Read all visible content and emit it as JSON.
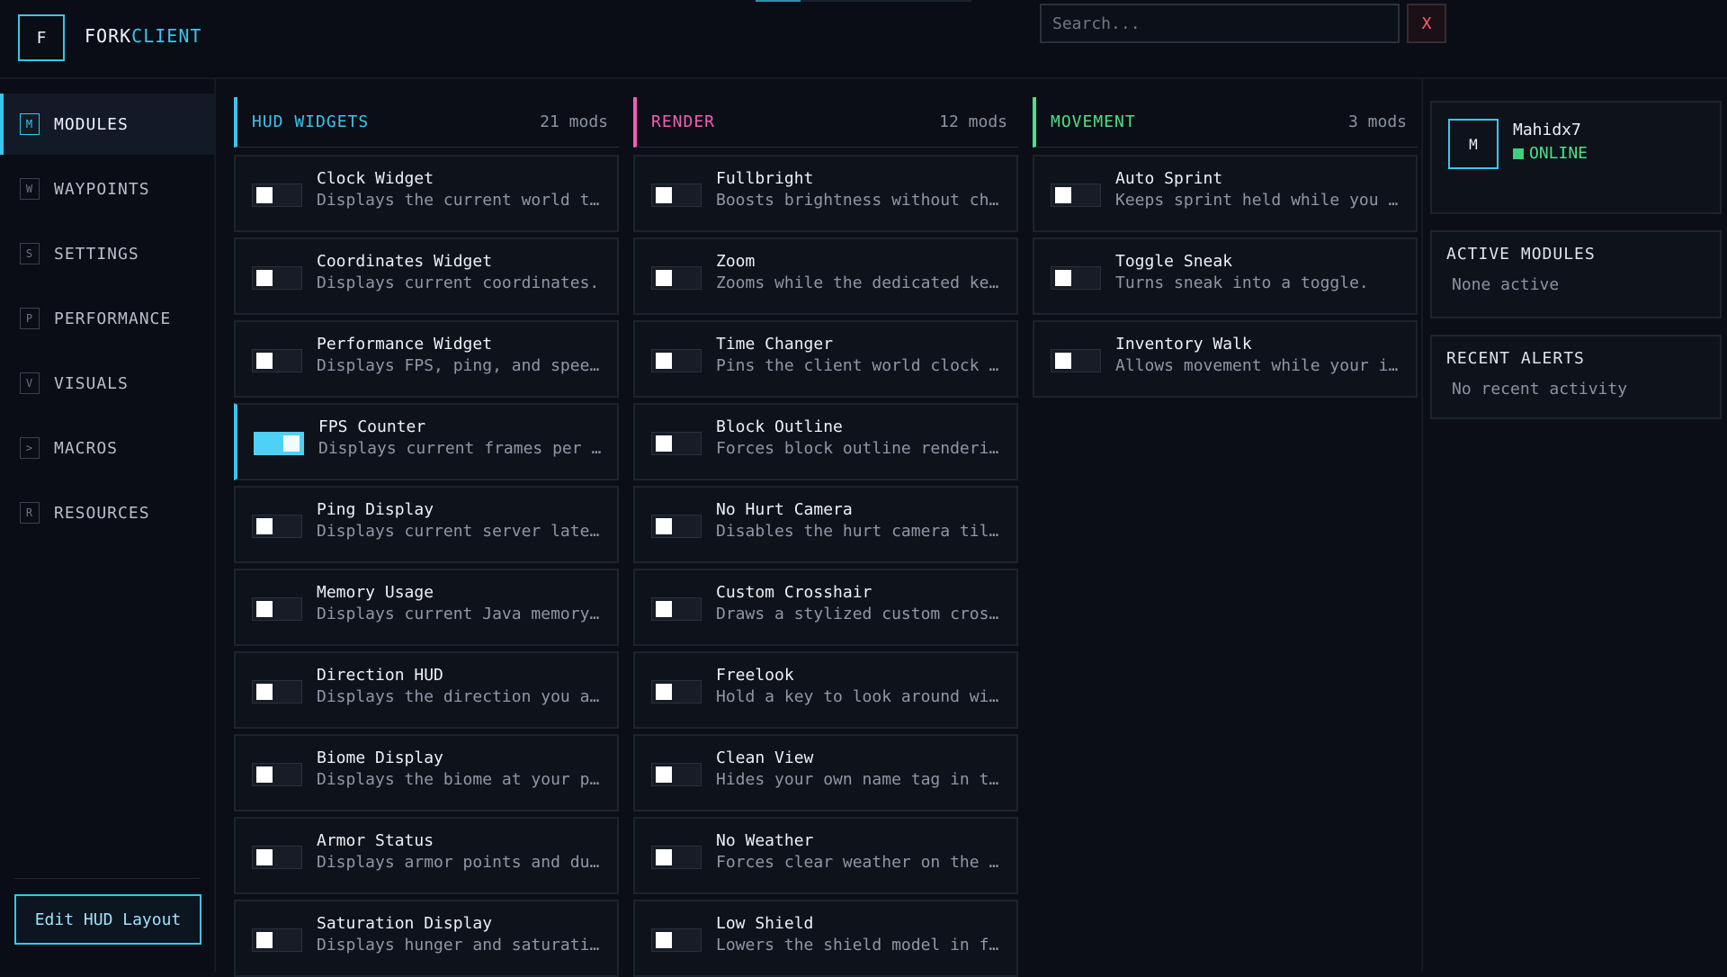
{
  "brand": {
    "logo_letter": "F",
    "name_primary": "FORK",
    "name_accent": "CLIENT",
    "accent_color": "#38c6ee"
  },
  "search": {
    "placeholder": "Search...",
    "clear_label": "X"
  },
  "sidebar": {
    "items": [
      {
        "icon": "M",
        "label": "MODULES",
        "active": true
      },
      {
        "icon": "W",
        "label": "WAYPOINTS",
        "active": false
      },
      {
        "icon": "S",
        "label": "SETTINGS",
        "active": false
      },
      {
        "icon": "P",
        "label": "PERFORMANCE",
        "active": false
      },
      {
        "icon": "V",
        "label": "VISUALS",
        "active": false
      },
      {
        "icon": ">",
        "label": "MACROS",
        "active": false
      },
      {
        "icon": "R",
        "label": "RESOURCES",
        "active": false
      }
    ],
    "edit_button": "Edit HUD Layout"
  },
  "columns": [
    {
      "title": "HUD WIDGETS",
      "count": "21 mods",
      "color": "#38c6ee",
      "mods": [
        {
          "name": "Clock Widget",
          "desc": "Displays the current world time.",
          "enabled": false
        },
        {
          "name": "Coordinates Widget",
          "desc": "Displays current coordinates.",
          "enabled": false
        },
        {
          "name": "Performance Widget",
          "desc": "Displays FPS, ping, and speed.",
          "enabled": false
        },
        {
          "name": "FPS Counter",
          "desc": "Displays current frames per s...",
          "enabled": true
        },
        {
          "name": "Ping Display",
          "desc": "Displays current server laten...",
          "enabled": false
        },
        {
          "name": "Memory Usage",
          "desc": "Displays current Java memory...",
          "enabled": false
        },
        {
          "name": "Direction HUD",
          "desc": "Displays the direction you are...",
          "enabled": false
        },
        {
          "name": "Biome Display",
          "desc": "Displays the biome at your pos...",
          "enabled": false
        },
        {
          "name": "Armor Status",
          "desc": "Displays armor points and dur...",
          "enabled": false
        },
        {
          "name": "Saturation Display",
          "desc": "Displays hunger and saturation.",
          "enabled": false
        }
      ]
    },
    {
      "title": "RENDER",
      "count": "12 mods",
      "color": "#f060b4",
      "mods": [
        {
          "name": "Fullbright",
          "desc": "Boosts brightness without cha...",
          "enabled": false
        },
        {
          "name": "Zoom",
          "desc": "Zooms while the dedicated key i...",
          "enabled": false
        },
        {
          "name": "Time Changer",
          "desc": "Pins the client world clock to n...",
          "enabled": false
        },
        {
          "name": "Block Outline",
          "desc": "Forces block outline renderin...",
          "enabled": false
        },
        {
          "name": "No Hurt Camera",
          "desc": "Disables the hurt camera tilt e...",
          "enabled": false
        },
        {
          "name": "Custom Crosshair",
          "desc": "Draws a stylized custom cross...",
          "enabled": false
        },
        {
          "name": "Freelook",
          "desc": "Hold a key to look around with...",
          "enabled": false
        },
        {
          "name": "Clean View",
          "desc": "Hides your own name tag in thi...",
          "enabled": false
        },
        {
          "name": "No Weather",
          "desc": "Forces clear weather on the ...",
          "enabled": false
        },
        {
          "name": "Low Shield",
          "desc": "Lowers the shield model in firs...",
          "enabled": false
        }
      ]
    },
    {
      "title": "MOVEMENT",
      "count": "3 mods",
      "color": "#4be08a",
      "mods": [
        {
          "name": "Auto Sprint",
          "desc": "Keeps sprint held while you ar...",
          "enabled": false
        },
        {
          "name": "Toggle Sneak",
          "desc": "Turns sneak into a toggle.",
          "enabled": false
        },
        {
          "name": "Inventory Walk",
          "desc": "Allows movement while your inv...",
          "enabled": false
        }
      ]
    }
  ],
  "profile": {
    "avatar_letter": "M",
    "username": "Mahidx7",
    "status": "ONLINE"
  },
  "active_modules": {
    "title": "ACTIVE MODULES",
    "text": "None active"
  },
  "recent_alerts": {
    "title": "RECENT ALERTS",
    "text": "No recent activity"
  }
}
